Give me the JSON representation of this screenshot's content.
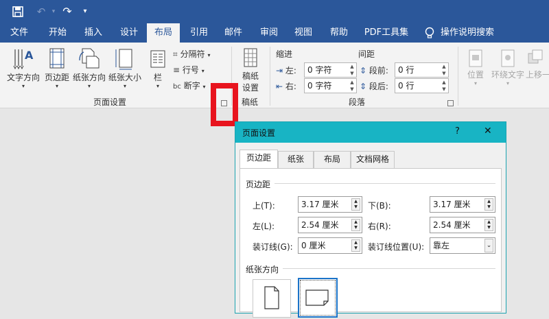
{
  "ribbon_tabs": [
    "文件",
    "开始",
    "插入",
    "设计",
    "布局",
    "引用",
    "邮件",
    "审阅",
    "视图",
    "帮助",
    "PDF工具集"
  ],
  "tell_me": "操作说明搜索",
  "page_setup_group": {
    "text_direction": "文字方向",
    "margins": "页边距",
    "orientation": "纸张方向",
    "size": "纸张大小",
    "columns": "栏",
    "breaks": "分隔符",
    "line_numbers": "行号",
    "hyphenation": "断字",
    "group_label": "页面设置"
  },
  "manuscript_group": {
    "button_line1": "稿纸",
    "button_line2": "设置",
    "group_label": "稿纸"
  },
  "paragraph_group": {
    "indent_label": "缩进",
    "spacing_label": "间距",
    "left_label": "左:",
    "right_label": "右:",
    "left_value": "0 字符",
    "right_value": "0 字符",
    "before_label": "段前:",
    "after_label": "段后:",
    "before_value": "0 行",
    "after_value": "0 行",
    "group_label": "段落"
  },
  "arrange_group": {
    "position": "位置",
    "wrap_text": "环绕文字",
    "bring_forward": "上移一"
  },
  "dialog": {
    "title": "页面设置",
    "help": "?",
    "close": "✕",
    "tabs": [
      "页边距",
      "纸张",
      "布局",
      "文档网格"
    ],
    "margins_section": "页边距",
    "top_label": "上(T):",
    "top_value": "3.17 厘米",
    "bottom_label": "下(B):",
    "bottom_value": "3.17 厘米",
    "left_label": "左(L):",
    "left_value": "2.54 厘米",
    "right_label": "右(R):",
    "right_value": "2.54 厘米",
    "gutter_label": "装订线(G):",
    "gutter_value": "0 厘米",
    "gutter_pos_label": "装订线位置(U):",
    "gutter_pos_value": "靠左",
    "orientation_section": "纸张方向"
  }
}
